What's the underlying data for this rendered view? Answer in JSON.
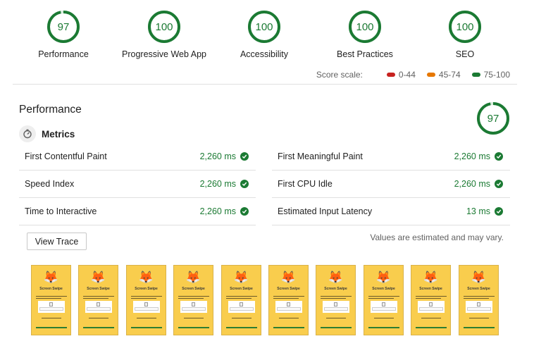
{
  "categories": [
    {
      "label": "Performance",
      "score": "97"
    },
    {
      "label": "Progressive Web App",
      "score": "100"
    },
    {
      "label": "Accessibility",
      "score": "100"
    },
    {
      "label": "Best Practices",
      "score": "100"
    },
    {
      "label": "SEO",
      "score": "100"
    }
  ],
  "score_scale": {
    "title": "Score scale:",
    "ranges": [
      {
        "label": "0-44",
        "color": "#c7221f"
      },
      {
        "label": "45-74",
        "color": "#e67700"
      },
      {
        "label": "75-100",
        "color": "#1b7a33"
      }
    ]
  },
  "performance": {
    "title": "Performance",
    "score": "97",
    "metrics_title": "Metrics",
    "metrics_left": [
      {
        "name": "First Contentful Paint",
        "value": "2,260 ms"
      },
      {
        "name": "Speed Index",
        "value": "2,260 ms"
      },
      {
        "name": "Time to Interactive",
        "value": "2,260 ms"
      }
    ],
    "metrics_right": [
      {
        "name": "First Meaningful Paint",
        "value": "2,260 ms"
      },
      {
        "name": "First CPU Idle",
        "value": "2,260 ms"
      },
      {
        "name": "Estimated Input Latency",
        "value": "13 ms"
      }
    ],
    "view_trace_label": "View Trace",
    "estimate_note": "Values are estimated and may vary."
  },
  "filmstrip": {
    "frame_title": "Screen Swipe",
    "frame_icon": "fox-emoji",
    "frame_glyph": "🦊",
    "frame_count": 10
  },
  "colors": {
    "pass": "#1b7a33",
    "pass_light": "#d7ecdc",
    "frame_bg": "#f9cd4d"
  }
}
